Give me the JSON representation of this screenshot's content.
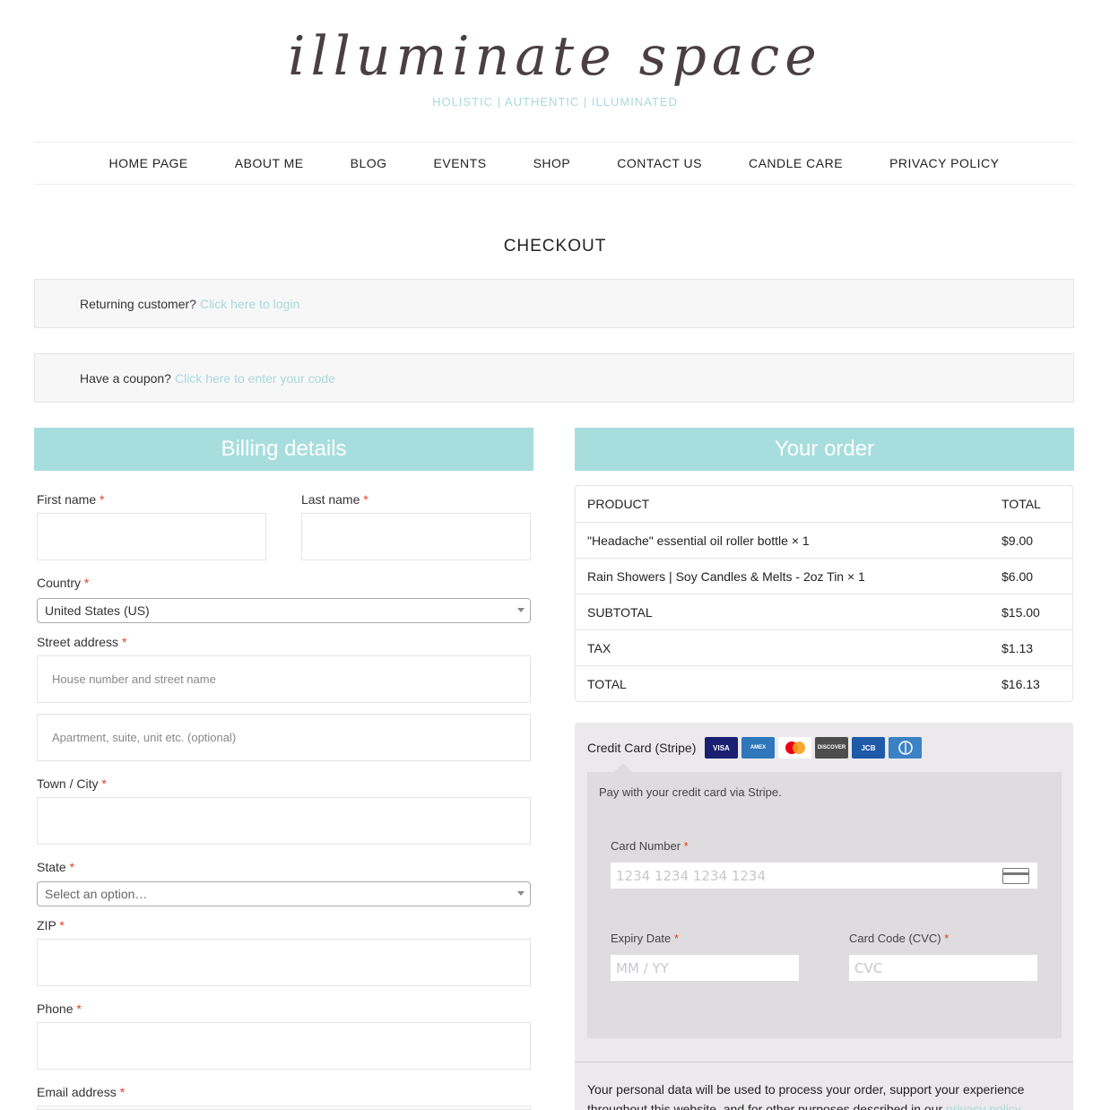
{
  "site": {
    "logo": "illuminate space",
    "tagline": "HOLISTIC | AUTHENTIC | ILLUMINATED"
  },
  "nav": [
    "HOME PAGE",
    "ABOUT ME",
    "BLOG",
    "EVENTS",
    "SHOP",
    "CONTACT US",
    "CANDLE CARE",
    "PRIVACY POLICY"
  ],
  "page_title": "CHECKOUT",
  "notices": {
    "login_text": "Returning customer?",
    "login_link": "Click here to login",
    "coupon_text": "Have a coupon?",
    "coupon_link": "Click here to enter your code"
  },
  "billing": {
    "heading": "Billing details",
    "required_mark": "*",
    "first_name": "First name",
    "last_name": "Last name",
    "country": "Country",
    "country_value": "United States (US)",
    "street": "Street address",
    "street_placeholder": "House number and street name",
    "apt_placeholder": "Apartment, suite, unit etc. (optional)",
    "city": "Town / City",
    "state": "State",
    "state_value": "Select an option…",
    "zip": "ZIP",
    "phone": "Phone",
    "email": "Email address"
  },
  "order": {
    "heading": "Your order",
    "col_product": "PRODUCT",
    "col_total": "TOTAL",
    "items": [
      {
        "name": "\"Headache\" essential oil roller bottle  × 1",
        "total": "$9.00"
      },
      {
        "name": "Rain Showers | Soy Candles & Melts - 2oz Tin  × 1",
        "total": "$6.00"
      }
    ],
    "subtotal_label": "SUBTOTAL",
    "subtotal": "$15.00",
    "tax_label": "TAX",
    "tax": "$1.13",
    "total_label": "TOTAL",
    "total": "$16.13"
  },
  "payment": {
    "method": "Credit Card (Stripe)",
    "cards": [
      "VISA",
      "AMEX",
      "MC",
      "DISCOVER",
      "JCB",
      "DINERS"
    ],
    "description": "Pay with your credit card via Stripe.",
    "card_number_label": "Card Number",
    "card_number_placeholder": "1234 1234 1234 1234",
    "expiry_label": "Expiry Date",
    "expiry_placeholder": "MM / YY",
    "cvc_label": "Card Code (CVC)",
    "cvc_placeholder": "CVC"
  },
  "privacy": {
    "text": "Your personal data will be used to process your order, support your experience throughout this website, and for other purposes described in our",
    "link": "privacy policy"
  }
}
